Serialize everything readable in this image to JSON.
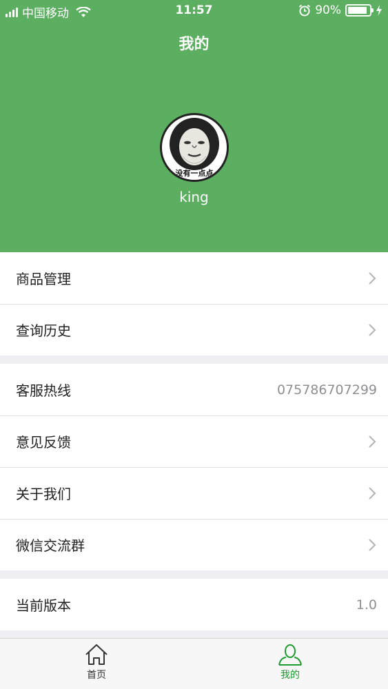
{
  "status_bar": {
    "carrier": "中国移动",
    "time": "11:57",
    "battery": "90%",
    "battery_level": 0.9
  },
  "header": {
    "title": "我的",
    "avatar_caption": "没有一点点",
    "username": "king"
  },
  "menu": {
    "goods_management": "商品管理",
    "query_history": "查询历史",
    "hotline_label": "客服热线",
    "hotline_value": "075786707299",
    "feedback": "意见反馈",
    "about_us": "关于我们",
    "wechat_group": "微信交流群",
    "version_label": "当前版本",
    "version_value": "1.0"
  },
  "tabs": {
    "home": "首页",
    "mine": "我的"
  },
  "colors": {
    "primary_green": "#5cae60",
    "tab_active": "#1b9a2e",
    "tab_inactive": "#333333"
  }
}
